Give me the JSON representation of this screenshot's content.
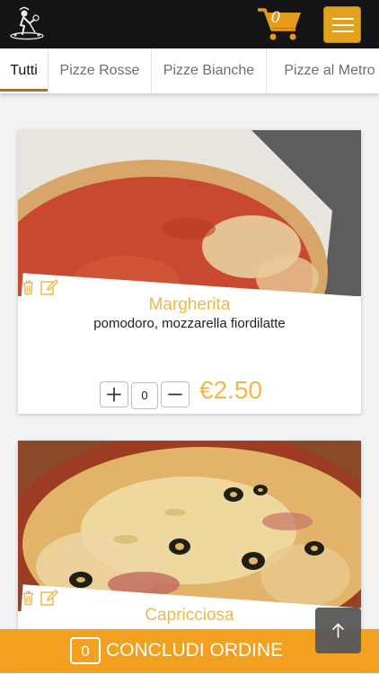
{
  "header": {
    "logo_icon": "pizzaiolo-logo-icon",
    "cart_icon": "shopping-cart-icon",
    "cart_count": "0",
    "menu_icon": "hamburger-menu-icon",
    "accent_color": "#e3a21c"
  },
  "tabs": [
    {
      "label": "Tutti",
      "active": true
    },
    {
      "label": "Pizze Rosse",
      "active": false
    },
    {
      "label": "Pizze Bianche",
      "active": false
    },
    {
      "label": "Pizze al Metro",
      "active": false
    }
  ],
  "products": [
    {
      "name": "Margherita",
      "description": "pomodoro, mozzarella fiordilatte",
      "quantity": "0",
      "price": "€2.50",
      "delete_icon": "trash-icon",
      "edit_icon": "edit-icon",
      "plus_icon": "plus-icon",
      "minus_icon": "minus-icon"
    },
    {
      "name": "Capricciosa",
      "delete_icon": "trash-icon",
      "edit_icon": "edit-icon"
    }
  ],
  "footer": {
    "order_count": "0",
    "checkout_label": "CONCLUDI ORDINE",
    "bg_color": "#f3a020"
  },
  "scroll_top_icon": "arrow-up-icon"
}
